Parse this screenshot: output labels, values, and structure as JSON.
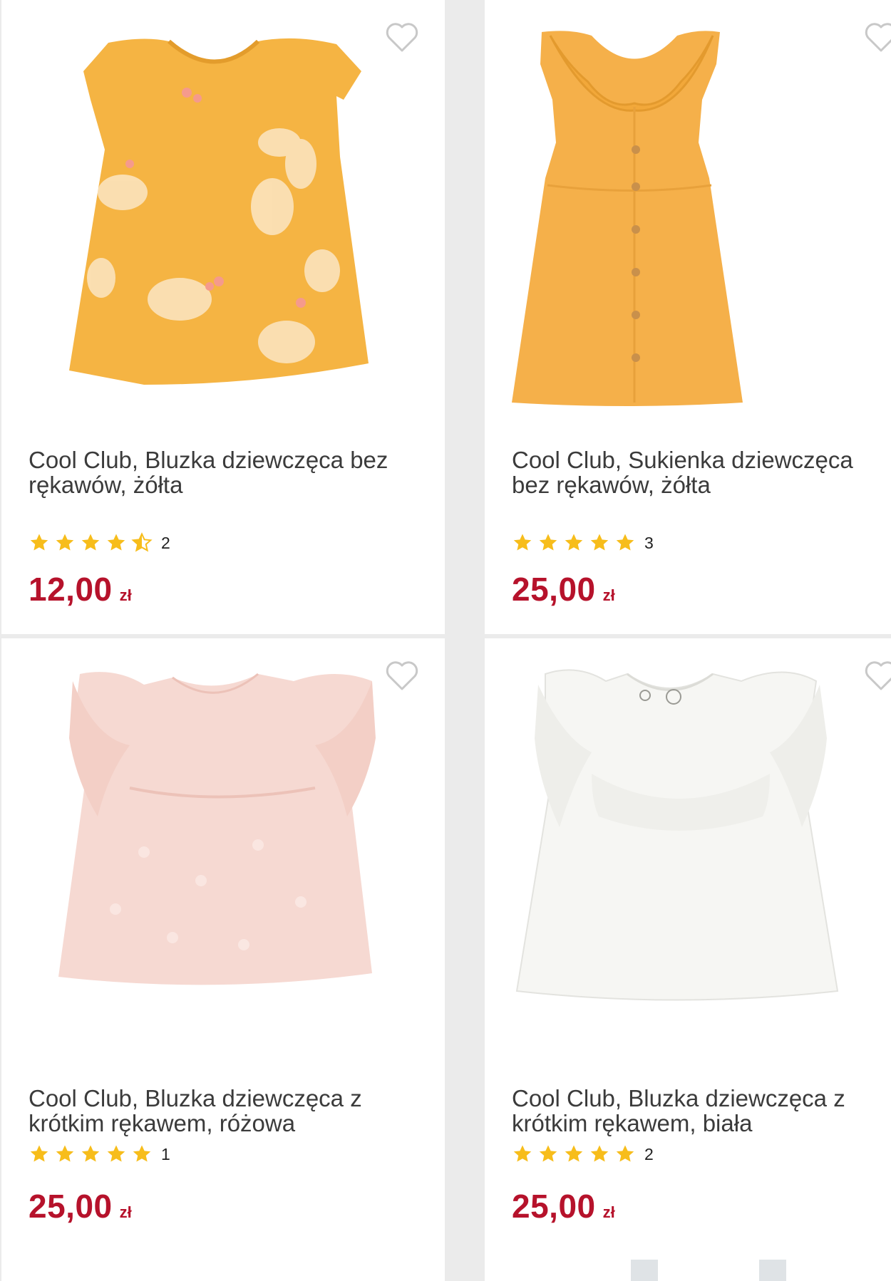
{
  "products": [
    {
      "title": "Cool Club, Bluzka dziewczęca bez rękawów, żółta",
      "rating": 4.5,
      "rating_count": "2",
      "price": "12,00",
      "currency": "zł",
      "image_color": "#f5b443"
    },
    {
      "title": "Cool Club, Sukienka dziewczęca bez rękawów, żółta",
      "rating": 5,
      "rating_count": "3",
      "price": "25,00",
      "currency": "zł",
      "image_color": "#f5b04a"
    },
    {
      "title": "Cool Club, Bluzka dziewczęca z krótkim rękawem, różowa",
      "rating": 5,
      "rating_count": "1",
      "price": "25,00",
      "currency": "zł",
      "image_color": "#f6d9d2"
    },
    {
      "title": "Cool Club, Bluzka dziewczęca z krótkim rękawem, biała",
      "rating": 5,
      "rating_count": "2",
      "price": "25,00",
      "currency": "zł",
      "image_color": "#f7f7f5"
    }
  ],
  "colors": {
    "price": "#b6122b",
    "star": "#f7bd1b",
    "background": "#ebebeb"
  },
  "icons": {
    "favorite": "heart-outline-icon",
    "rating": "star-icon"
  }
}
